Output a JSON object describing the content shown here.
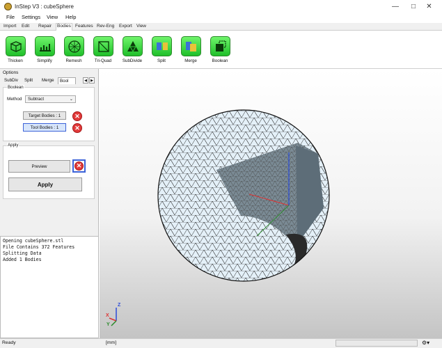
{
  "window": {
    "title": "InStep V3 : cubeSphere"
  },
  "menu": [
    "File",
    "Settings",
    "View",
    "Help"
  ],
  "ribbon_tabs": [
    "Import",
    "Edit",
    "Repair",
    "Bodies",
    "Features",
    "Rev-Eng",
    "Export",
    "View"
  ],
  "active_tab": "Bodies",
  "tools": [
    {
      "label": "Thicken",
      "icon": "thicken-icon"
    },
    {
      "label": "Simplify",
      "icon": "simplify-icon"
    },
    {
      "label": "Remesh",
      "icon": "remesh-icon"
    },
    {
      "label": "Tri-Quad",
      "icon": "tri-quad-icon"
    },
    {
      "label": "SubDivide",
      "icon": "subdivide-icon"
    },
    {
      "label": "Split",
      "icon": "split-icon"
    },
    {
      "label": "Merge",
      "icon": "merge-icon"
    },
    {
      "label": "Boolean",
      "icon": "boolean-icon"
    }
  ],
  "options": {
    "label": "Options",
    "tabs": [
      "SubDiv",
      "Split",
      "Merge",
      "Bool"
    ],
    "active_tab": "Bool",
    "boolean_group": "Boolean",
    "method_label": "Method",
    "method_value": "Subtract",
    "target_bodies": "Target Bodies : 1",
    "tool_bodies": "Tool Bodies : 1",
    "apply_group": "Apply",
    "preview_label": "Preview",
    "apply_label": "Apply"
  },
  "log": [
    "Opening cubeSphere.stl",
    "File Contains 372 Features",
    "Splitting Data",
    "Added 1 Bodies"
  ],
  "axes": {
    "x": "X",
    "y": "Y",
    "z": "Z"
  },
  "status": {
    "text": "Ready",
    "units": "[mm]"
  },
  "colors": {
    "tool_green": "#2fd33a",
    "mesh_fill": "#e6f2fa",
    "selected_blue": "#3b62d8",
    "close_red": "#e23a3a"
  }
}
